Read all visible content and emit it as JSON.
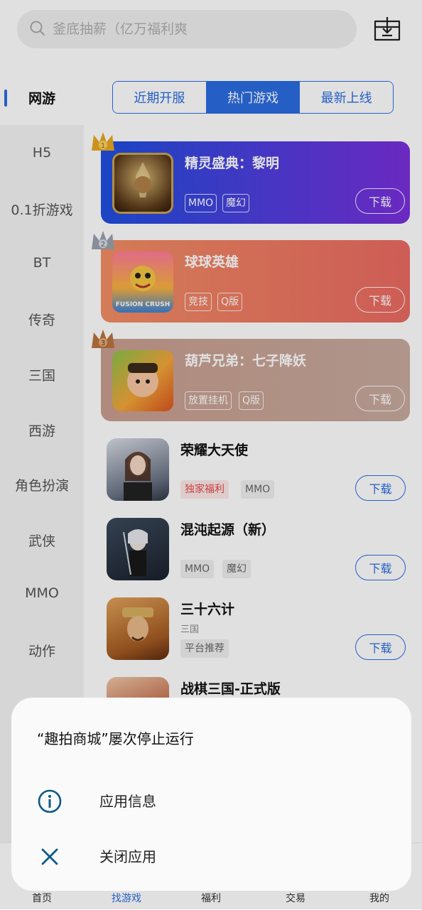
{
  "search": {
    "placeholder": "釜底抽薪（亿万福利爽"
  },
  "sidebar": {
    "active": "网游",
    "items": [
      "H5",
      "0.1折游戏",
      "BT",
      "传奇",
      "三国",
      "西游",
      "角色扮演",
      "武侠",
      "MMO",
      "动作"
    ]
  },
  "tabs": [
    {
      "label": "近期开服",
      "active": false
    },
    {
      "label": "热门游戏",
      "active": true
    },
    {
      "label": "最新上线",
      "active": false
    }
  ],
  "hot": [
    {
      "rank": "1",
      "title": "精灵盛典：黎明",
      "tags": [
        "MMO",
        "魔幻"
      ],
      "download": "下载"
    },
    {
      "rank": "2",
      "title": "球球英雄",
      "tags": [
        "竞技",
        "Q版"
      ],
      "download": "下载",
      "icon_text": "FUSION CRUSH"
    },
    {
      "rank": "3",
      "title": "葫芦兄弟：七子降妖",
      "tags": [
        "放置挂机",
        "Q版"
      ],
      "download": "下载"
    }
  ],
  "games": [
    {
      "title": "荣耀大天使",
      "tags": [
        "独家福利",
        "MMO"
      ],
      "download": "下载"
    },
    {
      "title": "混沌起源（新）",
      "tags": [
        "MMO",
        "魔幻"
      ],
      "download": "下载"
    },
    {
      "title": "三十六计",
      "sub": "三国",
      "tags": [
        "平台推荐"
      ],
      "download": "下载"
    },
    {
      "title": "战棋三国-正式版"
    }
  ],
  "bottom_nav": [
    "首页",
    "找游戏",
    "福利",
    "交易",
    "我的"
  ],
  "dialog": {
    "title": "“趣拍商城”屡次停止运行",
    "options": [
      {
        "icon": "info-icon",
        "label": "应用信息"
      },
      {
        "icon": "close-icon",
        "label": "关闭应用"
      }
    ]
  },
  "colors": {
    "accent": "#2b6de1",
    "card1": "#5b3ee0",
    "card2": "#f07c60",
    "card3": "#c9a493"
  }
}
